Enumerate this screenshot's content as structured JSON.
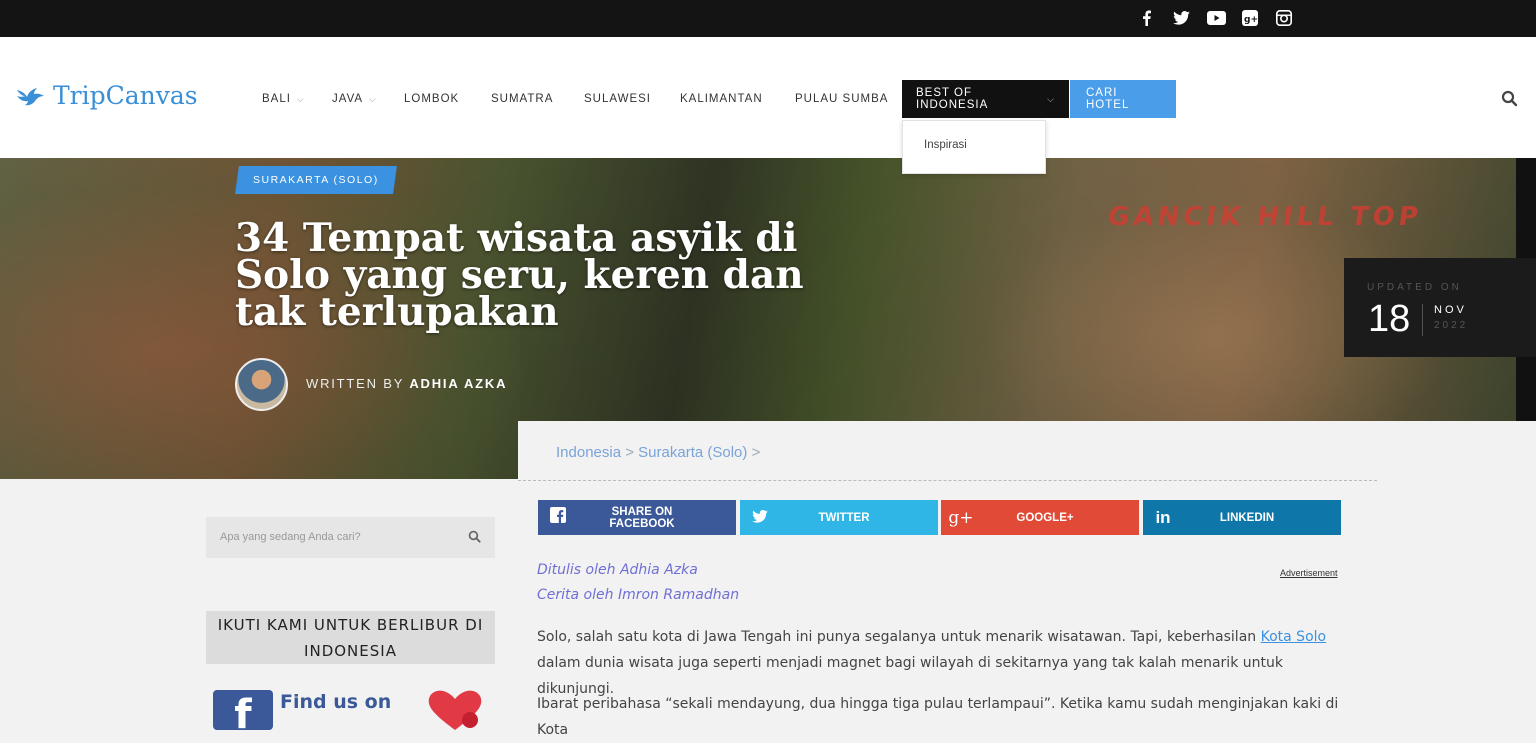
{
  "social": [
    "facebook-icon",
    "twitter-icon",
    "youtube-icon",
    "google-plus-icon",
    "instagram-icon"
  ],
  "header": {
    "logo": "TripCanvas",
    "nav": [
      {
        "label": "BALI",
        "has_dropdown": true
      },
      {
        "label": "JAVA",
        "has_dropdown": true
      },
      {
        "label": "LOMBOK"
      },
      {
        "label": "SUMATRA"
      },
      {
        "label": "SULAWESI"
      },
      {
        "label": "KALIMANTAN"
      },
      {
        "label": "PULAU SUMBA"
      },
      {
        "label": "BEST OF INDONESIA",
        "has_dropdown": true,
        "active": true
      },
      {
        "label": "CARI HOTEL"
      }
    ],
    "dropdown_items": [
      "Inspirasi"
    ]
  },
  "hero": {
    "category": "SURAKARTA (SOLO)",
    "title": "34 Tempat wisata asyik di Solo yang seru, keren dan tak terlupakan",
    "sign_text": "GANCIK HILL TOP",
    "written_by_label": "WRITTEN BY",
    "author": "ADHIA AZKA",
    "updated_label": "UPDATED ON",
    "day": "18",
    "month": "NOV",
    "year": "2022"
  },
  "breadcrumb": {
    "items": [
      "Indonesia",
      "Surakarta (Solo)"
    ],
    "sep": ">"
  },
  "share": [
    {
      "label": "SHARE ON FACEBOOK",
      "color": "#3b5998"
    },
    {
      "label": "TWITTER",
      "color": "#2fb6e6"
    },
    {
      "label": "GOOGLE+",
      "color": "#e04a36"
    },
    {
      "label": "LINKEDIN",
      "color": "#0e76a8"
    }
  ],
  "article": {
    "written_by": "Ditulis oleh Adhia Azka",
    "story_by": "Cerita oleh Imron Ramadhan",
    "advertisement": "Advertisement",
    "p1_before": "Solo, salah satu kota di Jawa Tengah ini punya segalanya untuk menarik wisatawan. Tapi, keberhasilan ",
    "p1_link": "Kota Solo",
    "p1_after": " dalam dunia wisata juga seperti menjadi magnet bagi wilayah di sekitarnya yang tak kalah menarik untuk dikunjungi.",
    "p2": "Ibarat peribahasa “sekali mendayung, dua hingga tiga pulau terlampaui”. Ketika kamu sudah menginjakan kaki di Kota"
  },
  "sidebar": {
    "search_placeholder": "Apa yang sedang Anda cari?",
    "follow_title": "IKUTI KAMI UNTUK BERLIBUR DI INDONESIA",
    "fb_text": "Find us on"
  }
}
